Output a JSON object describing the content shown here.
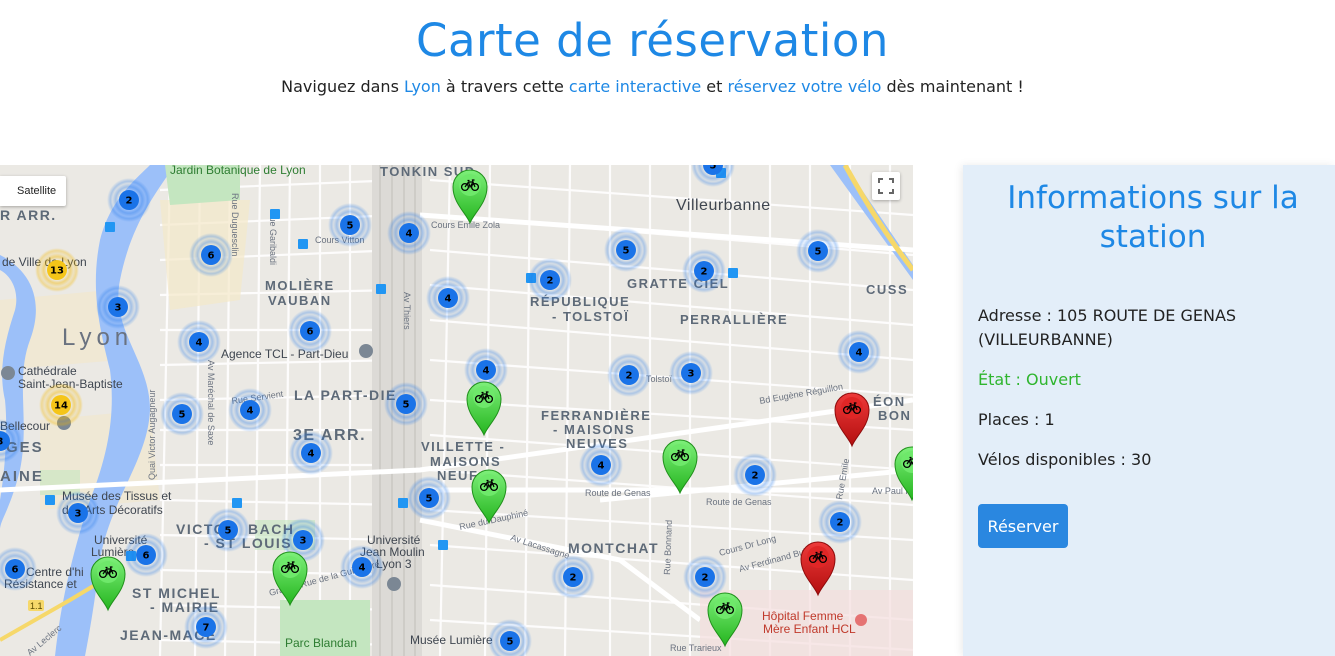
{
  "header": {
    "title": "Carte de réservation",
    "subtitle_1": "Naviguez dans ",
    "subtitle_link_city": "Lyon",
    "subtitle_2": " à travers cette ",
    "subtitle_link_map": "carte interactive",
    "subtitle_3": " et ",
    "subtitle_link_book": "réservez votre vélo",
    "subtitle_4": " dès maintenant !"
  },
  "map": {
    "type_toggle_label": "Satellite",
    "labels": {
      "jardin": "Jardin Botanique de Lyon",
      "tonkin": "TONKIN SUD",
      "villeurbanne": "Villeurbanne",
      "arr1": "R ARR.",
      "lyon": "Lyon",
      "moliere1": "MOLIÈRE",
      "moliere2": "VAUBAN",
      "gratte": "GRATTE CIEL",
      "republique1": "RÉPUBLIQUE",
      "republique2": "- TOLSTOÏ",
      "perrallière": "PERRALLIÈRE",
      "cusset": "CUSS",
      "agence": "Agence TCL - Part-Dieu",
      "cathedrale1": "Cathédrale",
      "cathedrale2": "Saint-Jean-Baptiste",
      "partdieu": "LA PART-DIE",
      "arr3": "3E ARR.",
      "ferrandiere1": "FERRANDIÈRE",
      "ferrandiere2": "- MAISONS",
      "ferrandiere3": "NEUVES",
      "villette1": "VILLETTE -",
      "villette2": "MAISONS",
      "villette3": "NEUF",
      "leon1": "ÉON",
      "leon2": "BON",
      "musee1": "Musée des Tissus et",
      "musee2": "des Arts Décoratifs",
      "victor1": "VICTOR",
      "victor2": "BACH",
      "victor3": "- ST LOUIS",
      "universite1": "Université",
      "universite2": "Lumière",
      "jeanmoulin1": "Université",
      "jeanmoulin2": "Jean Moulin",
      "jeanmoulin3": "Lyon 3",
      "montchat": "MONTCHAT",
      "stmichel1": "ST MICHEL",
      "stmichel2": "- MAIRIE",
      "jeanmace": "JEAN-MACÉ",
      "centre1": "Centre d'hi",
      "centre2": "Résistance et",
      "hopital1": "Hôpital Femme",
      "hopital2": "Mère Enfant HCL",
      "blandan": "Parc Blandan",
      "musee_lumiere": "Musée Lumière",
      "bellecour": "Bellecour",
      "ages": "GES",
      "aine": "AINE",
      "villelyon": "de Ville de Lyon",
      "cours_vitton": "Cours Vitton",
      "cours_zola": "Cours Emile Zola",
      "route_genas1": "Route de Genas",
      "route_genas2": "Route de Genas",
      "rue_dauphine": "Rue du Dauphiné",
      "av_lacassagne": "Av Lacassagne",
      "cours_long": "Cours Dr Long",
      "av_ferdinand": "Av Ferdinand Buisson",
      "bd_reguillon": "Bd Eugène Réguillon",
      "rue_trarieux": "Rue Trarieux",
      "av_thiers": "Av Thiers",
      "rue_garibaldi": "Rue Garibaldi",
      "rue_duguesclin": "Rue Duguesclin",
      "rue_crequi": "Rue Créqui",
      "av_marechal": "Av Maréchal de Saxe",
      "av_victor": "Quai Victor Augagneur",
      "rue_servient": "Rue Servient",
      "rue_guillotiere": "Grande Rue de la Guillotière",
      "av_leclerc": "Av Leclerc",
      "rue_emile": "Rue Emile",
      "av_paul": "Av Paul K",
      "rue_bonnand": "Rue Bonnand",
      "tolstoi": "Tolstoï",
      "highway": "1.1"
    },
    "clusters": [
      "2",
      "13",
      "3",
      "6",
      "5",
      "4",
      "4",
      "2",
      "5",
      "2",
      "5",
      "4",
      "6",
      "4",
      "4",
      "14",
      "5",
      "4",
      "2",
      "3",
      "5",
      "4",
      "4",
      "3",
      "5",
      "5",
      "3",
      "6",
      "4",
      "2",
      "2",
      "6",
      "3",
      "7",
      "2",
      "2",
      "5",
      "5"
    ],
    "green_markers": 8,
    "red_markers": 2
  },
  "panel": {
    "title_line1": "Informations sur la",
    "title_line2": "station",
    "address": "Adresse : 105 ROUTE DE GENAS",
    "address_city": "(VILLEURBANNE)",
    "state": "État : Ouvert",
    "places": "Places : 1",
    "bikes": "Vélos disponibles : 30",
    "reserve_label": "Réserver"
  },
  "colors": {
    "accent": "#1e88e5",
    "open_state": "#2fb52f",
    "cluster_blue": "#1a73e8",
    "cluster_yellow": "#f5c518",
    "marker_green": "#3cc83c",
    "marker_red": "#d01818",
    "panel_bg": "#e3eef9"
  }
}
